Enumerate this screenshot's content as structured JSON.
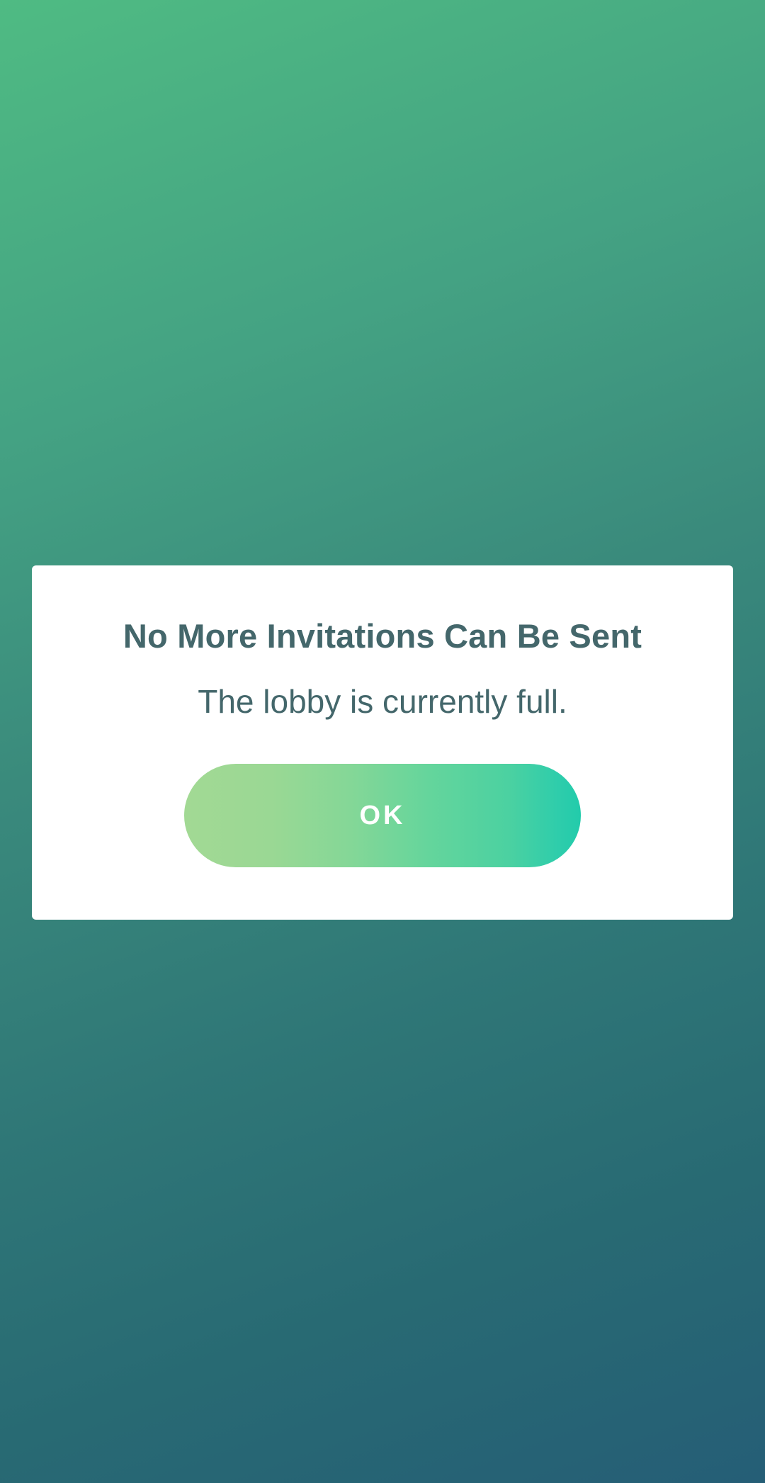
{
  "dialog": {
    "title": "No More Invitations Can Be Sent",
    "message": "The lobby is currently full.",
    "ok_label": "OK"
  },
  "colors": {
    "background_top": "#4fbb83",
    "background_bottom": "#255e76",
    "dialog_background": "#ffffff",
    "text": "#44676b",
    "button_gradient_start": "#a2d994",
    "button_gradient_end": "#22cbab",
    "button_text": "#ffffff"
  }
}
